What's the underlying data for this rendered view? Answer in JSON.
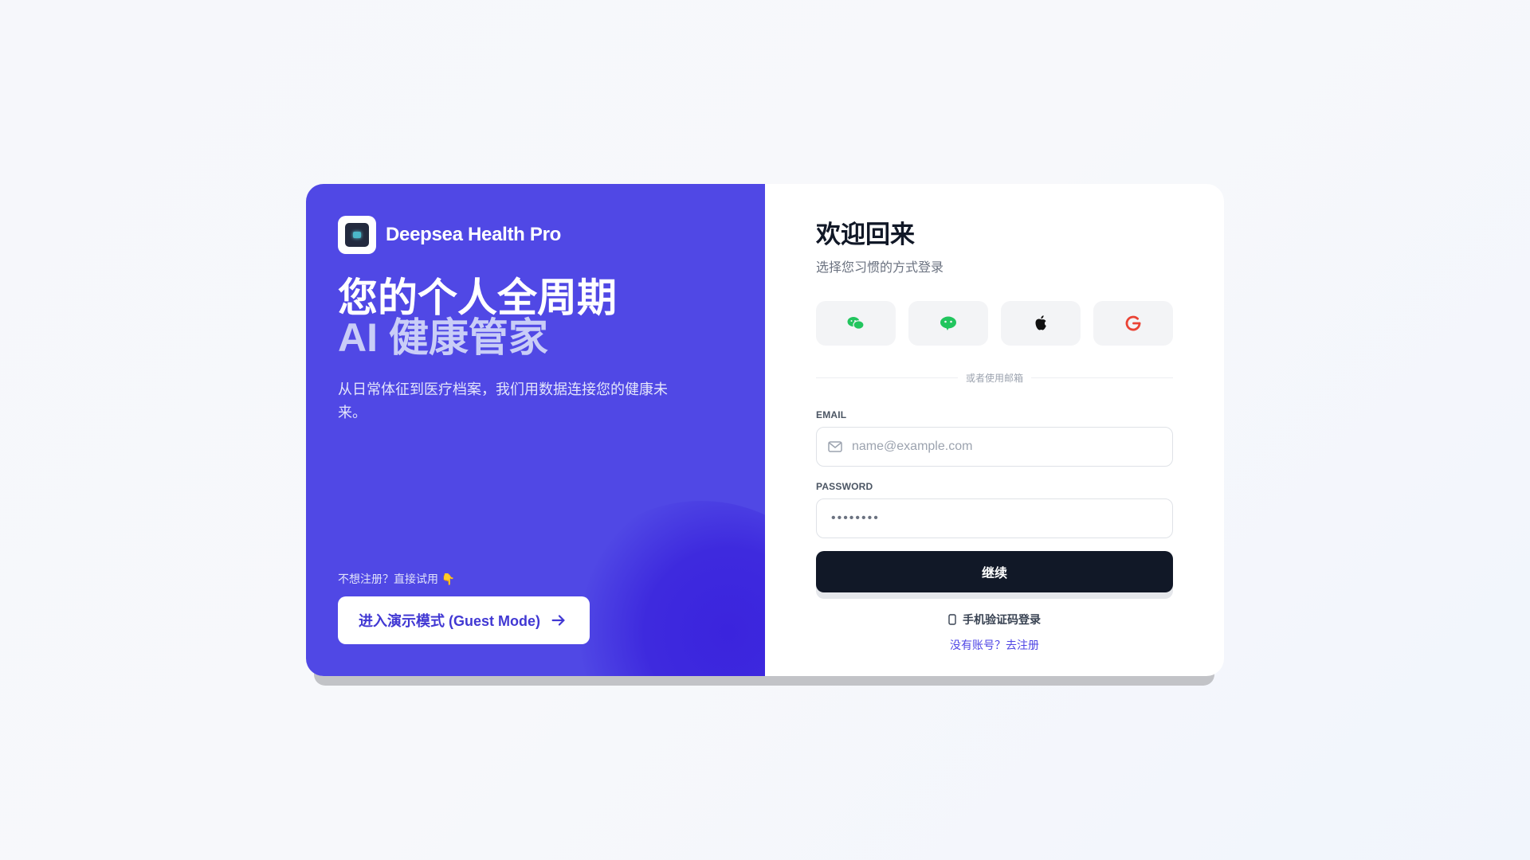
{
  "brand": {
    "name": "Deepsea Health Pro"
  },
  "hero": {
    "headline_line1": "您的个人全周期",
    "headline_line2": "AI 健康管家",
    "tagline": "从日常体征到医疗档案，我们用数据连接您的健康未来。"
  },
  "guest": {
    "hint": "不想注册？直接试用 👇",
    "button_label": "进入演示模式 (Guest Mode)"
  },
  "login": {
    "title": "欢迎回来",
    "subtitle": "选择您习惯的方式登录",
    "social": [
      {
        "icon": "wechat-icon",
        "color": "#22c55e"
      },
      {
        "icon": "line-chat-icon",
        "color": "#22c55e"
      },
      {
        "icon": "apple-icon",
        "color": "#111111"
      },
      {
        "icon": "google-icon",
        "color": "#ea4335"
      }
    ],
    "divider_text": "或者使用邮箱",
    "email_label": "EMAIL",
    "email_placeholder": "name@example.com",
    "password_label": "PASSWORD",
    "password_mask": "••••••••",
    "submit_label": "继续",
    "phone_login_label": "手机验证码登录",
    "register_link": "没有账号？去注册"
  },
  "colors": {
    "accent": "#5048e5",
    "dark_button": "#111827",
    "link": "#4f46e5"
  }
}
